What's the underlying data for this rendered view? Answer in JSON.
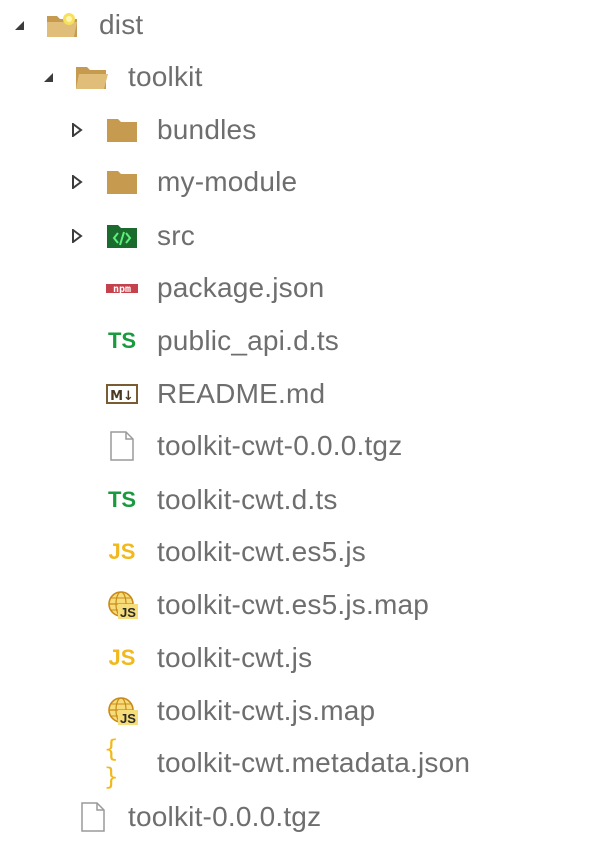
{
  "explorer": {
    "items": [
      {
        "label": "dist",
        "icon": "open-folder-icon",
        "expanded": true
      },
      {
        "label": "toolkit",
        "icon": "open-folder-icon",
        "expanded": true
      },
      {
        "label": "bundles",
        "icon": "folder-icon",
        "expanded": false
      },
      {
        "label": "my-module",
        "icon": "folder-icon",
        "expanded": false
      },
      {
        "label": "src",
        "icon": "src-folder-icon",
        "expanded": false
      },
      {
        "label": "package.json",
        "icon": "npm-icon",
        "icon_text": "npm"
      },
      {
        "label": "public_api.d.ts",
        "icon": "typescript-icon",
        "icon_text": "TS"
      },
      {
        "label": "README.md",
        "icon": "markdown-icon",
        "icon_text": "M↓"
      },
      {
        "label": "toolkit-cwt-0.0.0.tgz",
        "icon": "file-icon"
      },
      {
        "label": "toolkit-cwt.d.ts",
        "icon": "typescript-icon",
        "icon_text": "TS"
      },
      {
        "label": "toolkit-cwt.es5.js",
        "icon": "javascript-icon",
        "icon_text": "JS"
      },
      {
        "label": "toolkit-cwt.es5.js.map",
        "icon": "js-map-icon",
        "icon_text": "JS"
      },
      {
        "label": "toolkit-cwt.js",
        "icon": "javascript-icon",
        "icon_text": "JS"
      },
      {
        "label": "toolkit-cwt.js.map",
        "icon": "js-map-icon",
        "icon_text": "JS"
      },
      {
        "label": "toolkit-cwt.metadata.json",
        "icon": "json-braces-icon",
        "icon_text": "{ }"
      },
      {
        "label": "toolkit-0.0.0.tgz",
        "icon": "file-icon"
      }
    ]
  },
  "colors": {
    "label": "#6e6e6e",
    "folder": "#c69b4f",
    "src_folder": "#1c6b2e",
    "typescript": "#1a9a3e",
    "javascript": "#f1b91c",
    "npm": "#c3424b",
    "markdown": "#7a5c32"
  }
}
